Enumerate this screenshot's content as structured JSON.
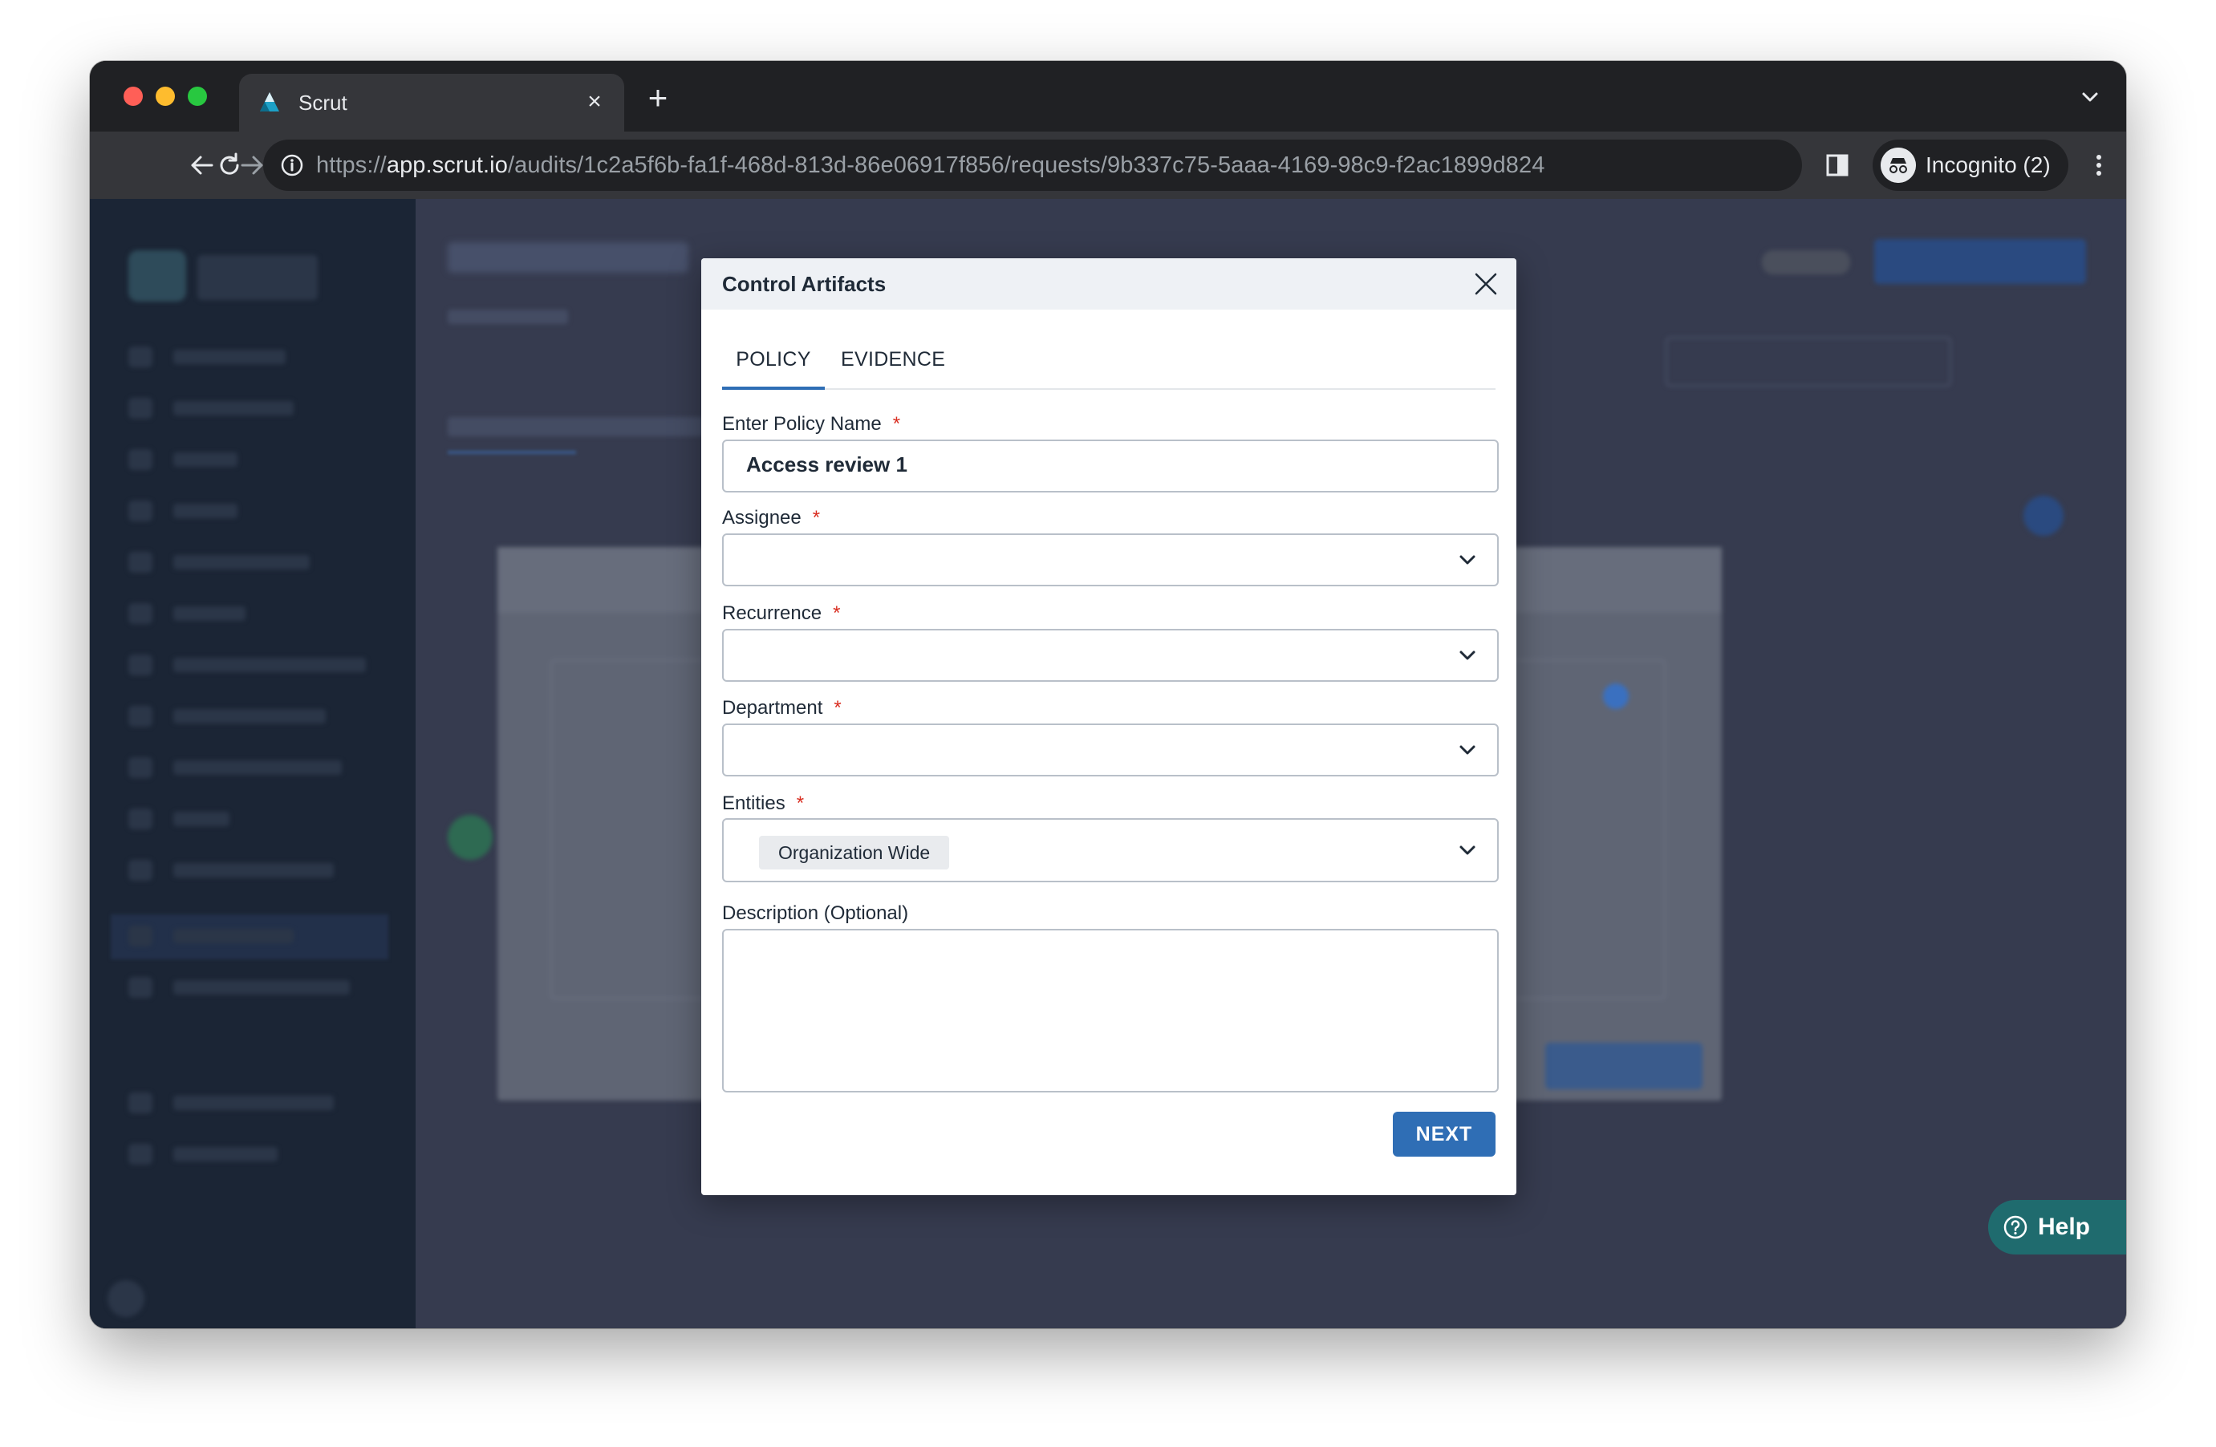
{
  "browser": {
    "tab_title": "Scrut",
    "url_scheme": "https://",
    "url_host": "app.scrut.io",
    "url_path": "/audits/1c2a5f6b-fa1f-468d-813d-86e06917f856/requests/9b337c75-5aaa-4169-98c9-f2ac1899d824",
    "incognito_label": "Incognito (2)"
  },
  "modal": {
    "title": "Control Artifacts",
    "tabs": [
      {
        "label": "POLICY",
        "active": true
      },
      {
        "label": "EVIDENCE",
        "active": false
      }
    ],
    "fields": {
      "policy_name": {
        "label": "Enter Policy Name",
        "required": "*",
        "value": "Access review 1"
      },
      "assignee": {
        "label": "Assignee",
        "required": "*",
        "value": ""
      },
      "recurrence": {
        "label": "Recurrence",
        "required": "*",
        "value": ""
      },
      "department": {
        "label": "Department",
        "required": "*",
        "value": ""
      },
      "entities": {
        "label": "Entities",
        "required": "*",
        "chips": [
          "Organization Wide"
        ]
      },
      "description": {
        "label": "Description (Optional)",
        "value": ""
      }
    },
    "next_label": "NEXT"
  },
  "help": {
    "label": "Help"
  },
  "colors": {
    "accent": "#2f6eb5",
    "required": "#d92d20",
    "help": "#1f6b6e",
    "overlay": "#363b4f"
  }
}
